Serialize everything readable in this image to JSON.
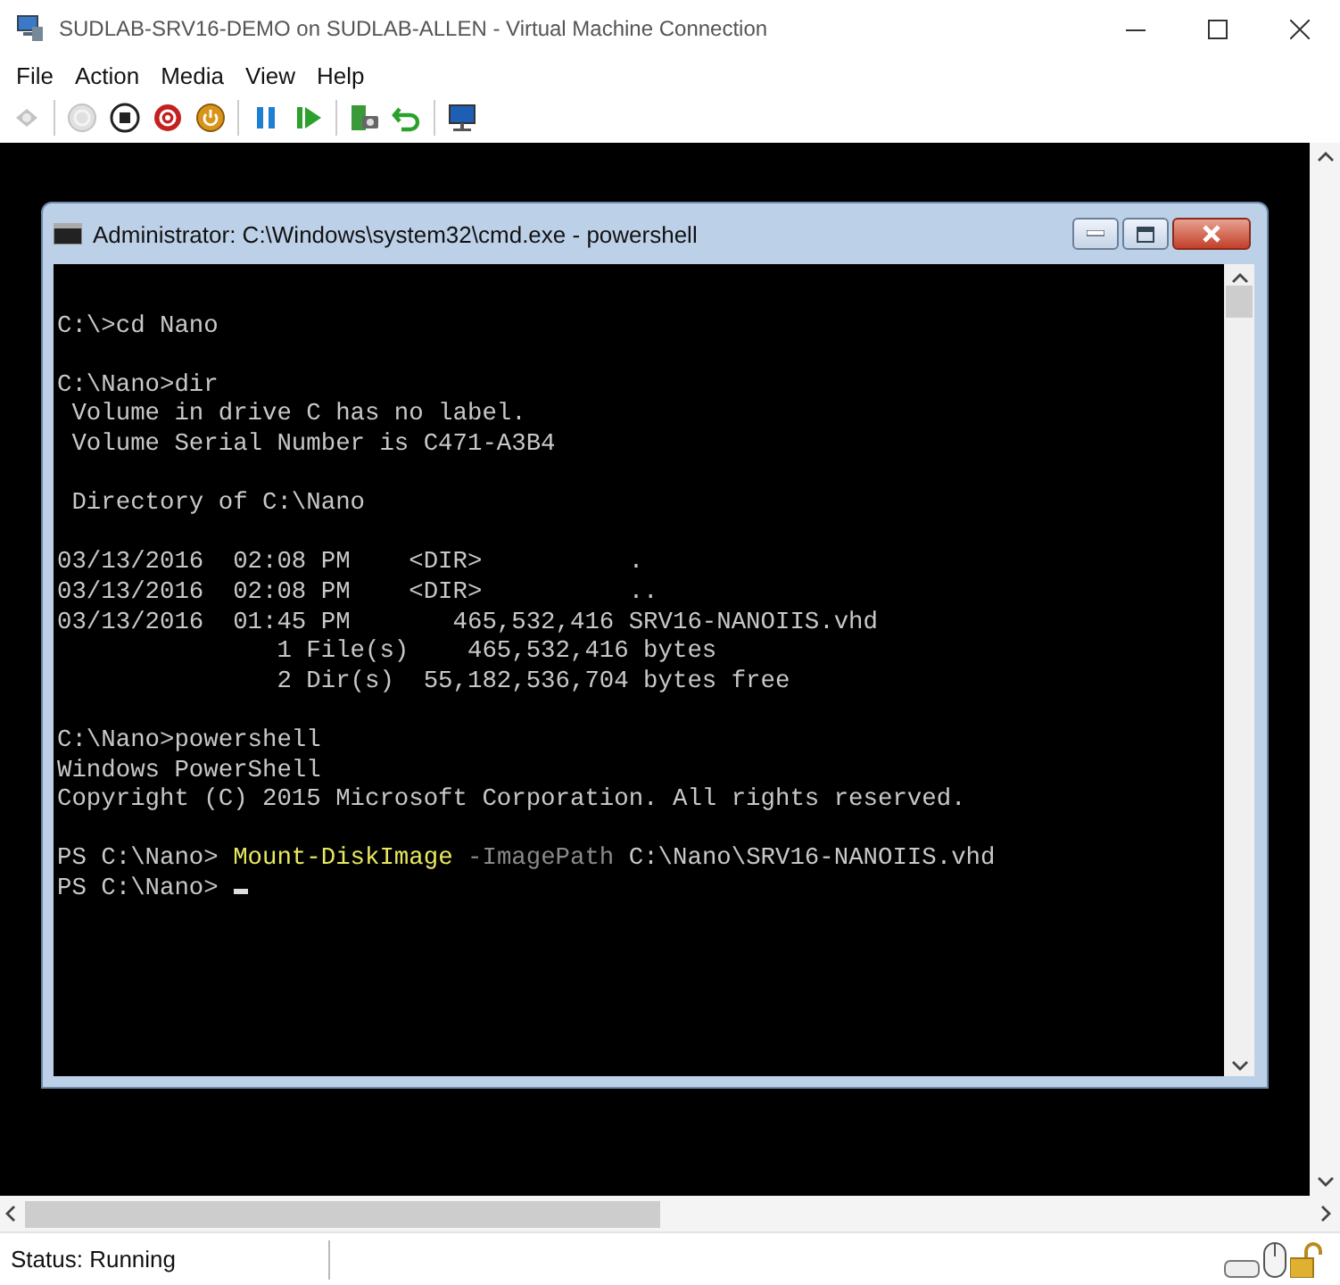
{
  "window": {
    "title": "SUDLAB-SRV16-DEMO on SUDLAB-ALLEN - Virtual Machine Connection"
  },
  "menu": [
    "File",
    "Action",
    "Media",
    "View",
    "Help"
  ],
  "toolbar": [
    {
      "kind": "ctrl-alt-del",
      "disabled": true
    },
    {
      "kind": "start",
      "disabled": true
    },
    {
      "kind": "turn-off",
      "disabled": false
    },
    {
      "kind": "shut-down",
      "disabled": false
    },
    {
      "kind": "save",
      "disabled": false
    },
    {
      "kind": "pause",
      "disabled": false
    },
    {
      "kind": "resume",
      "disabled": false
    },
    {
      "kind": "checkpoint",
      "disabled": false
    },
    {
      "kind": "revert",
      "disabled": false
    },
    {
      "kind": "enhanced-session",
      "disabled": false
    }
  ],
  "console": {
    "title": "Administrator: C:\\Windows\\system32\\cmd.exe - powershell",
    "lines": [
      {
        "kind": "blank"
      },
      {
        "kind": "text",
        "segments": [
          {
            "kind": "plain",
            "text": "C:\\>cd Nano"
          }
        ]
      },
      {
        "kind": "blank"
      },
      {
        "kind": "text",
        "segments": [
          {
            "kind": "plain",
            "text": "C:\\Nano>dir"
          }
        ]
      },
      {
        "kind": "text",
        "segments": [
          {
            "kind": "plain",
            "text": " Volume in drive C has no label."
          }
        ]
      },
      {
        "kind": "text",
        "segments": [
          {
            "kind": "plain",
            "text": " Volume Serial Number is C471-A3B4"
          }
        ]
      },
      {
        "kind": "blank"
      },
      {
        "kind": "text",
        "segments": [
          {
            "kind": "plain",
            "text": " Directory of C:\\Nano"
          }
        ]
      },
      {
        "kind": "blank"
      },
      {
        "kind": "text",
        "segments": [
          {
            "kind": "plain",
            "text": "03/13/2016  02:08 PM    <DIR>          ."
          }
        ]
      },
      {
        "kind": "text",
        "segments": [
          {
            "kind": "plain",
            "text": "03/13/2016  02:08 PM    <DIR>          .."
          }
        ]
      },
      {
        "kind": "text",
        "segments": [
          {
            "kind": "plain",
            "text": "03/13/2016  01:45 PM       465,532,416 SRV16-NANOIIS.vhd"
          }
        ]
      },
      {
        "kind": "text",
        "segments": [
          {
            "kind": "plain",
            "text": "               1 File(s)    465,532,416 bytes"
          }
        ]
      },
      {
        "kind": "text",
        "segments": [
          {
            "kind": "plain",
            "text": "               2 Dir(s)  55,182,536,704 bytes free"
          }
        ]
      },
      {
        "kind": "blank"
      },
      {
        "kind": "text",
        "segments": [
          {
            "kind": "plain",
            "text": "C:\\Nano>powershell"
          }
        ]
      },
      {
        "kind": "text",
        "segments": [
          {
            "kind": "plain",
            "text": "Windows PowerShell"
          }
        ]
      },
      {
        "kind": "text",
        "segments": [
          {
            "kind": "plain",
            "text": "Copyright (C) 2015 Microsoft Corporation. All rights reserved."
          }
        ]
      },
      {
        "kind": "blank"
      },
      {
        "kind": "text",
        "segments": [
          {
            "kind": "plain",
            "text": "PS C:\\Nano> "
          },
          {
            "kind": "command",
            "text": "Mount-DiskImage"
          },
          {
            "kind": "parameter",
            "text": " -ImagePath"
          },
          {
            "kind": "plain",
            "text": " C:\\Nano\\SRV16-NANOIIS.vhd"
          }
        ]
      },
      {
        "kind": "prompt",
        "segments": [
          {
            "kind": "plain",
            "text": "PS C:\\Nano> "
          }
        ]
      }
    ]
  },
  "status_bar": {
    "status": "Status: Running"
  }
}
